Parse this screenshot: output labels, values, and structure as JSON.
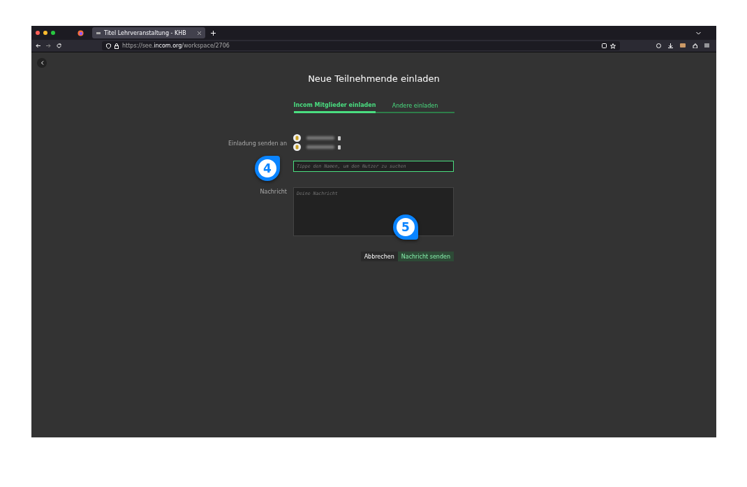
{
  "browser": {
    "tab_title": "Titel Lehrveranstaltung - KHB",
    "url_host": "https://see.",
    "url_domain": "incom.org",
    "url_path": "/workspace/2706"
  },
  "page": {
    "title": "Neue Teilnehmende einladen",
    "tabs": [
      {
        "label": "Incom Mitglieder einladen",
        "selected": true
      },
      {
        "label": "Andere einladen",
        "selected": false
      }
    ],
    "recipients_label": "Einladung senden an",
    "recipients": [
      {
        "kind": "blurred"
      },
      {
        "kind": "blurred"
      }
    ],
    "search": {
      "placeholder": "Tippe den Namen, um den Nutzer zu suchen"
    },
    "message_label": "Nachricht",
    "message": {
      "placeholder": "Deine Nachricht"
    },
    "buttons": [
      {
        "label": "Abbrechen",
        "kind": "secondary"
      },
      {
        "label": "Nachricht senden",
        "kind": "primary"
      }
    ]
  },
  "callouts": [
    {
      "label": "4",
      "kind": "right"
    },
    {
      "label": "5",
      "kind": "down"
    }
  ]
}
